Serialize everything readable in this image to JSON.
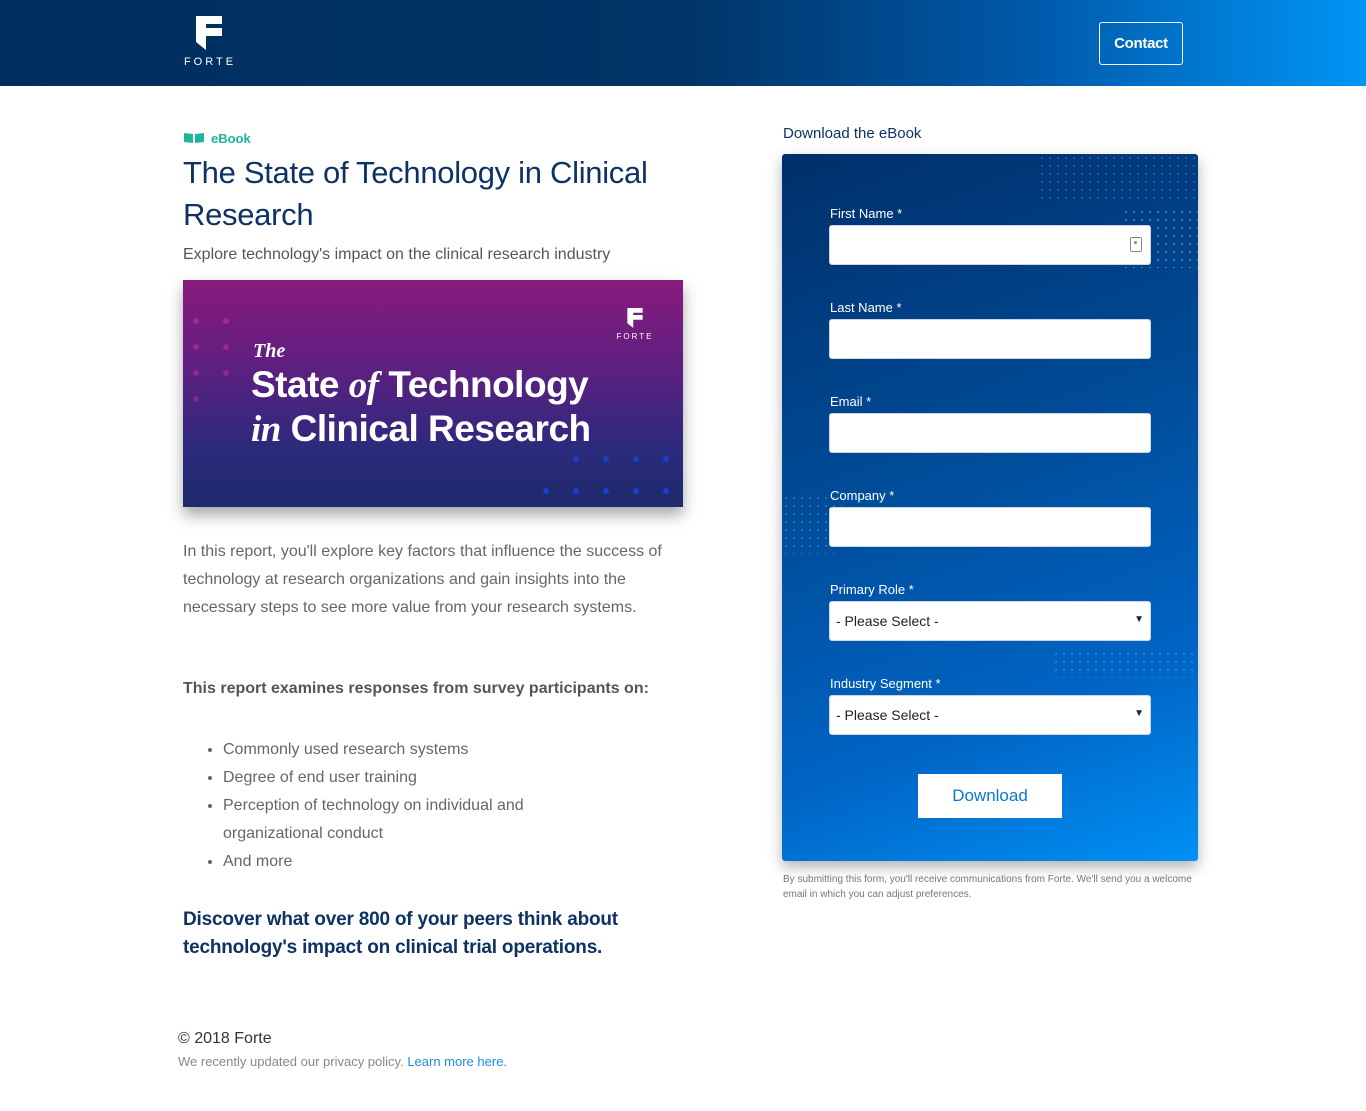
{
  "header": {
    "logo_text": "FORTE",
    "contact_label": "Contact"
  },
  "main": {
    "tag": "eBook",
    "title": "The State of Technology in Clinical Research",
    "subtitle": "Explore technology's impact on the clinical research industry",
    "cover": {
      "logo_text": "FORTE",
      "the": "The",
      "line1_a": "State ",
      "line1_of": "of",
      "line1_b": " Technology",
      "line2_in": "in",
      "line2_b": " Clinical Research"
    },
    "body": "In this report, you'll explore key factors that influence the success of technology at research organizations and gain insights into the necessary steps to see more value from your research systems.",
    "examines": "This report examines responses from survey participants on:",
    "list": [
      "Commonly used research systems",
      "Degree of end user training",
      "Perception of technology on individual and organizational conduct",
      "And more"
    ],
    "discover": "Discover what over 800 of your peers think about technology's impact on clinical trial operations."
  },
  "form": {
    "title": "Download the eBook",
    "fields": {
      "first_name": "First Name *",
      "last_name": "Last Name *",
      "email": "Email *",
      "company": "Company *",
      "primary_role": "Primary Role *",
      "industry_segment": "Industry Segment *"
    },
    "select_default": "- Please Select -",
    "download_label": "Download",
    "disclaimer": "By submitting this form, you'll receive communications from Forte. We'll send you a welcome email in which you can adjust preferences."
  },
  "footer": {
    "copyright": "© 2018 Forte",
    "policy_text": "We recently updated our privacy policy.",
    "policy_link": "Learn more here."
  },
  "colors": {
    "navy": "#0e3263",
    "teal": "#1fb59a",
    "link_blue": "#1a8fe0"
  }
}
